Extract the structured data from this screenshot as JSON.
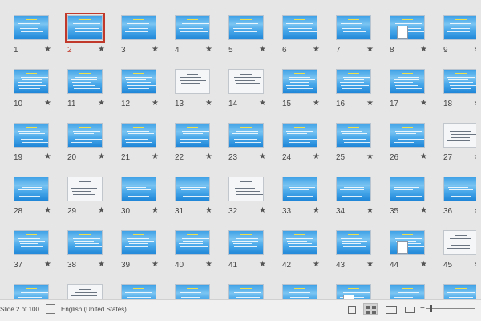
{
  "sorter": {
    "slides": [
      {
        "n": "1",
        "style": "blue"
      },
      {
        "n": "2",
        "style": "blue",
        "selected": true
      },
      {
        "n": "3",
        "style": "blue"
      },
      {
        "n": "4",
        "style": "blue"
      },
      {
        "n": "5",
        "style": "blue"
      },
      {
        "n": "6",
        "style": "blue"
      },
      {
        "n": "7",
        "style": "blue"
      },
      {
        "n": "8",
        "style": "blue-fig"
      },
      {
        "n": "9",
        "style": "blue"
      },
      {
        "n": "10",
        "style": "blue"
      },
      {
        "n": "11",
        "style": "blue"
      },
      {
        "n": "12",
        "style": "blue"
      },
      {
        "n": "13",
        "style": "white"
      },
      {
        "n": "14",
        "style": "white"
      },
      {
        "n": "15",
        "style": "blue"
      },
      {
        "n": "16",
        "style": "blue"
      },
      {
        "n": "17",
        "style": "blue"
      },
      {
        "n": "18",
        "style": "blue"
      },
      {
        "n": "19",
        "style": "blue"
      },
      {
        "n": "20",
        "style": "blue"
      },
      {
        "n": "21",
        "style": "blue"
      },
      {
        "n": "22",
        "style": "blue"
      },
      {
        "n": "23",
        "style": "blue"
      },
      {
        "n": "24",
        "style": "blue"
      },
      {
        "n": "25",
        "style": "blue"
      },
      {
        "n": "26",
        "style": "blue"
      },
      {
        "n": "27",
        "style": "white"
      },
      {
        "n": "28",
        "style": "blue"
      },
      {
        "n": "29",
        "style": "white"
      },
      {
        "n": "30",
        "style": "blue"
      },
      {
        "n": "31",
        "style": "blue"
      },
      {
        "n": "32",
        "style": "white"
      },
      {
        "n": "33",
        "style": "blue"
      },
      {
        "n": "34",
        "style": "blue"
      },
      {
        "n": "35",
        "style": "blue"
      },
      {
        "n": "36",
        "style": "blue"
      },
      {
        "n": "37",
        "style": "blue"
      },
      {
        "n": "38",
        "style": "blue"
      },
      {
        "n": "39",
        "style": "blue"
      },
      {
        "n": "40",
        "style": "blue"
      },
      {
        "n": "41",
        "style": "blue"
      },
      {
        "n": "42",
        "style": "blue"
      },
      {
        "n": "43",
        "style": "blue"
      },
      {
        "n": "44",
        "style": "blue-fig"
      },
      {
        "n": "45",
        "style": "white"
      },
      {
        "n": "",
        "style": "blue"
      },
      {
        "n": "",
        "style": "white"
      },
      {
        "n": "",
        "style": "blue"
      },
      {
        "n": "",
        "style": "blue"
      },
      {
        "n": "",
        "style": "blue"
      },
      {
        "n": "",
        "style": "blue"
      },
      {
        "n": "",
        "style": "blue-fig"
      },
      {
        "n": "",
        "style": "blue"
      },
      {
        "n": "",
        "style": "blue"
      }
    ],
    "star_glyph": "★",
    "selected_color": "#c0392b"
  },
  "status_bar": {
    "slide_info": "Slide 2 of 100",
    "language": "English (United States)"
  }
}
